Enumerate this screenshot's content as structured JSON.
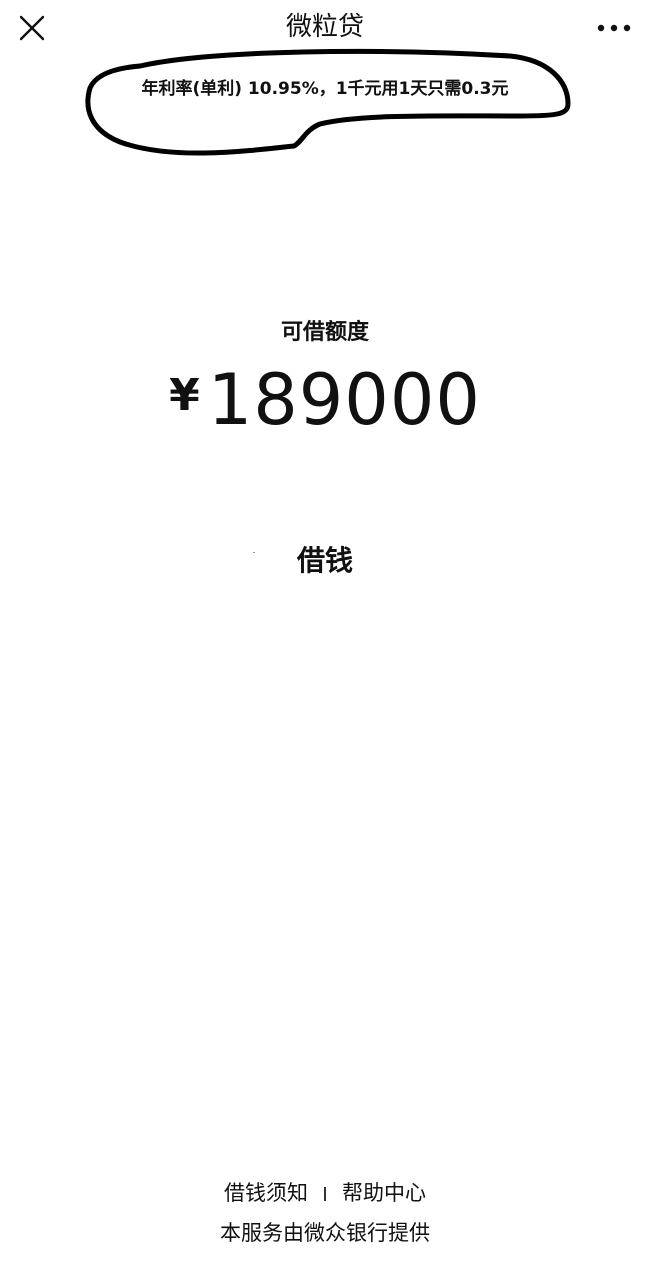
{
  "nav": {
    "title": "微粒贷",
    "close_icon": "close-icon",
    "more_icon": "more-icon"
  },
  "notice": {
    "rate_text": "年利率(单利) 10.95%，1千元用1天只需0.3元"
  },
  "credit": {
    "label": "可借额度",
    "currency_symbol": "¥",
    "amount": "189000"
  },
  "actions": {
    "borrow_label": "借钱"
  },
  "footer": {
    "link_notice": "借钱须知",
    "link_help": "帮助中心",
    "provider": "本服务由微众银行提供"
  }
}
